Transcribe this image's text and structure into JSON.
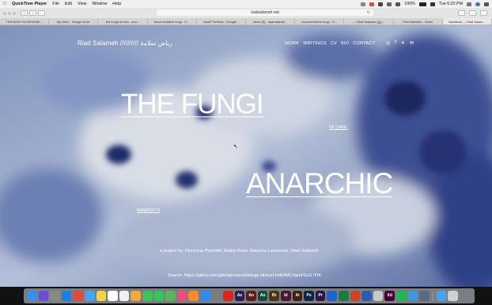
{
  "menubar": {
    "app_name": "QuickTime Player",
    "menus": [
      "File",
      "Edit",
      "View",
      "Window",
      "Help"
    ],
    "battery": "100%",
    "clock": "Tue 6:20 PM"
  },
  "toolbar": {
    "url": "riadsalameh.net",
    "back_glyph": "‹",
    "forward_glyph": "›",
    "reload_glyph": "↻"
  },
  "tabs": [
    "THE BODY IN MOVEME...",
    "My Drive - Google Drive",
    "the fungit of care - ana...",
    "documentation fungi - G...",
    "DAAP Portfolio - Google...",
    "Inbox (5) - riadnsalame...",
    "documentation fungi - G...",
    "— Riad Salameh (((((...",
    "Post Attendee - Zoom",
    "Manifesto — Riad Salam..."
  ],
  "site": {
    "name": "Riad Salameh ////////// رياض سلامة",
    "nav": [
      "WORK",
      "WRITINGS",
      "CV",
      "BIO",
      "CONTACT"
    ],
    "social_icons": [
      "instagram-icon",
      "facebook-icon",
      "twitter-icon",
      "email-icon"
    ],
    "social_glyphs": [
      "◎",
      "f",
      "✦",
      "✉"
    ],
    "title_1": "THE FUNGI",
    "of_care": "OF CARE:",
    "title_2": "ANARCHIC",
    "manifesto": "MANIFESTO",
    "project": "a project by: Florencia Pochinki, Maikki Buko, Natacha Lamounier, Riad Salameh",
    "source": "Source: https://giphy.com/gifs/lab-microbiology-clinical-HdHfMCVgmF6zG iYtK"
  },
  "dock": {
    "apps": [
      {
        "name": "finder-icon",
        "color": "#3b8fe8",
        "label": ""
      },
      {
        "name": "siri-icon",
        "color": "#6b4bd8",
        "label": ""
      },
      {
        "name": "launchpad-icon",
        "color": "#8a8a8a",
        "label": ""
      },
      {
        "name": "safari-icon",
        "color": "#1e7fdc",
        "label": ""
      },
      {
        "name": "chrome-icon",
        "color": "#e24a3b",
        "label": ""
      },
      {
        "name": "mail-icon",
        "color": "#4aa3f0",
        "label": ""
      },
      {
        "name": "notes-icon",
        "color": "#f5d44a",
        "label": ""
      },
      {
        "name": "calendar-icon",
        "color": "#ffffff",
        "label": ""
      },
      {
        "name": "reminders-icon",
        "color": "#f0f0f0",
        "label": ""
      },
      {
        "name": "photos-icon",
        "color": "#f2a93b",
        "label": ""
      },
      {
        "name": "facetime-icon",
        "color": "#3cc35a",
        "label": ""
      },
      {
        "name": "messages-icon",
        "color": "#33c659",
        "label": ""
      },
      {
        "name": "maps-icon",
        "color": "#5fb35f",
        "label": ""
      },
      {
        "name": "itunes-icon",
        "color": "#ef4e78",
        "label": ""
      },
      {
        "name": "books-icon",
        "color": "#f28b2b",
        "label": ""
      },
      {
        "name": "appstore-icon",
        "color": "#2d8cf0",
        "label": ""
      },
      {
        "name": "preferences-icon",
        "color": "#7d7d7d",
        "label": ""
      },
      {
        "name": "acrobat-icon",
        "color": "#d8261f",
        "label": ""
      },
      {
        "name": "aftereffects-icon",
        "color": "#2a1f53",
        "label": "Ae"
      },
      {
        "name": "animate-icon",
        "color": "#5a1f17",
        "label": "An"
      },
      {
        "name": "audition-icon",
        "color": "#1d4a40",
        "label": "Au"
      },
      {
        "name": "bridge-icon",
        "color": "#4a3510",
        "label": "Br"
      },
      {
        "name": "indesign-icon",
        "color": "#4a1832",
        "label": "Id"
      },
      {
        "name": "illustrator-icon",
        "color": "#3a2310",
        "label": "Ai"
      },
      {
        "name": "photoshop-icon",
        "color": "#0f2740",
        "label": "Ps"
      },
      {
        "name": "premiere-icon",
        "color": "#2a1848",
        "label": "Pr"
      },
      {
        "name": "outlook-icon",
        "color": "#1e64c8",
        "label": ""
      },
      {
        "name": "excel-icon",
        "color": "#1d7a45",
        "label": ""
      },
      {
        "name": "powerpoint-icon",
        "color": "#d04423",
        "label": ""
      },
      {
        "name": "word-icon",
        "color": "#2a5cb0",
        "label": ""
      },
      {
        "name": "help-icon",
        "color": "#c9c9c9",
        "label": ""
      },
      {
        "name": "xd-icon",
        "color": "#470137",
        "label": "Xd"
      },
      {
        "name": "spotify-icon",
        "color": "#1db954",
        "label": ""
      },
      {
        "name": "cleaner-icon",
        "color": "#3a9ad9",
        "label": ""
      },
      {
        "name": "quicktime-icon",
        "color": "#5a6a80",
        "label": ""
      }
    ],
    "trailing": [
      {
        "name": "downloads-icon",
        "color": "#4aa3f0",
        "label": ""
      },
      {
        "name": "trash-icon",
        "color": "#d0d0d0",
        "label": ""
      }
    ]
  }
}
